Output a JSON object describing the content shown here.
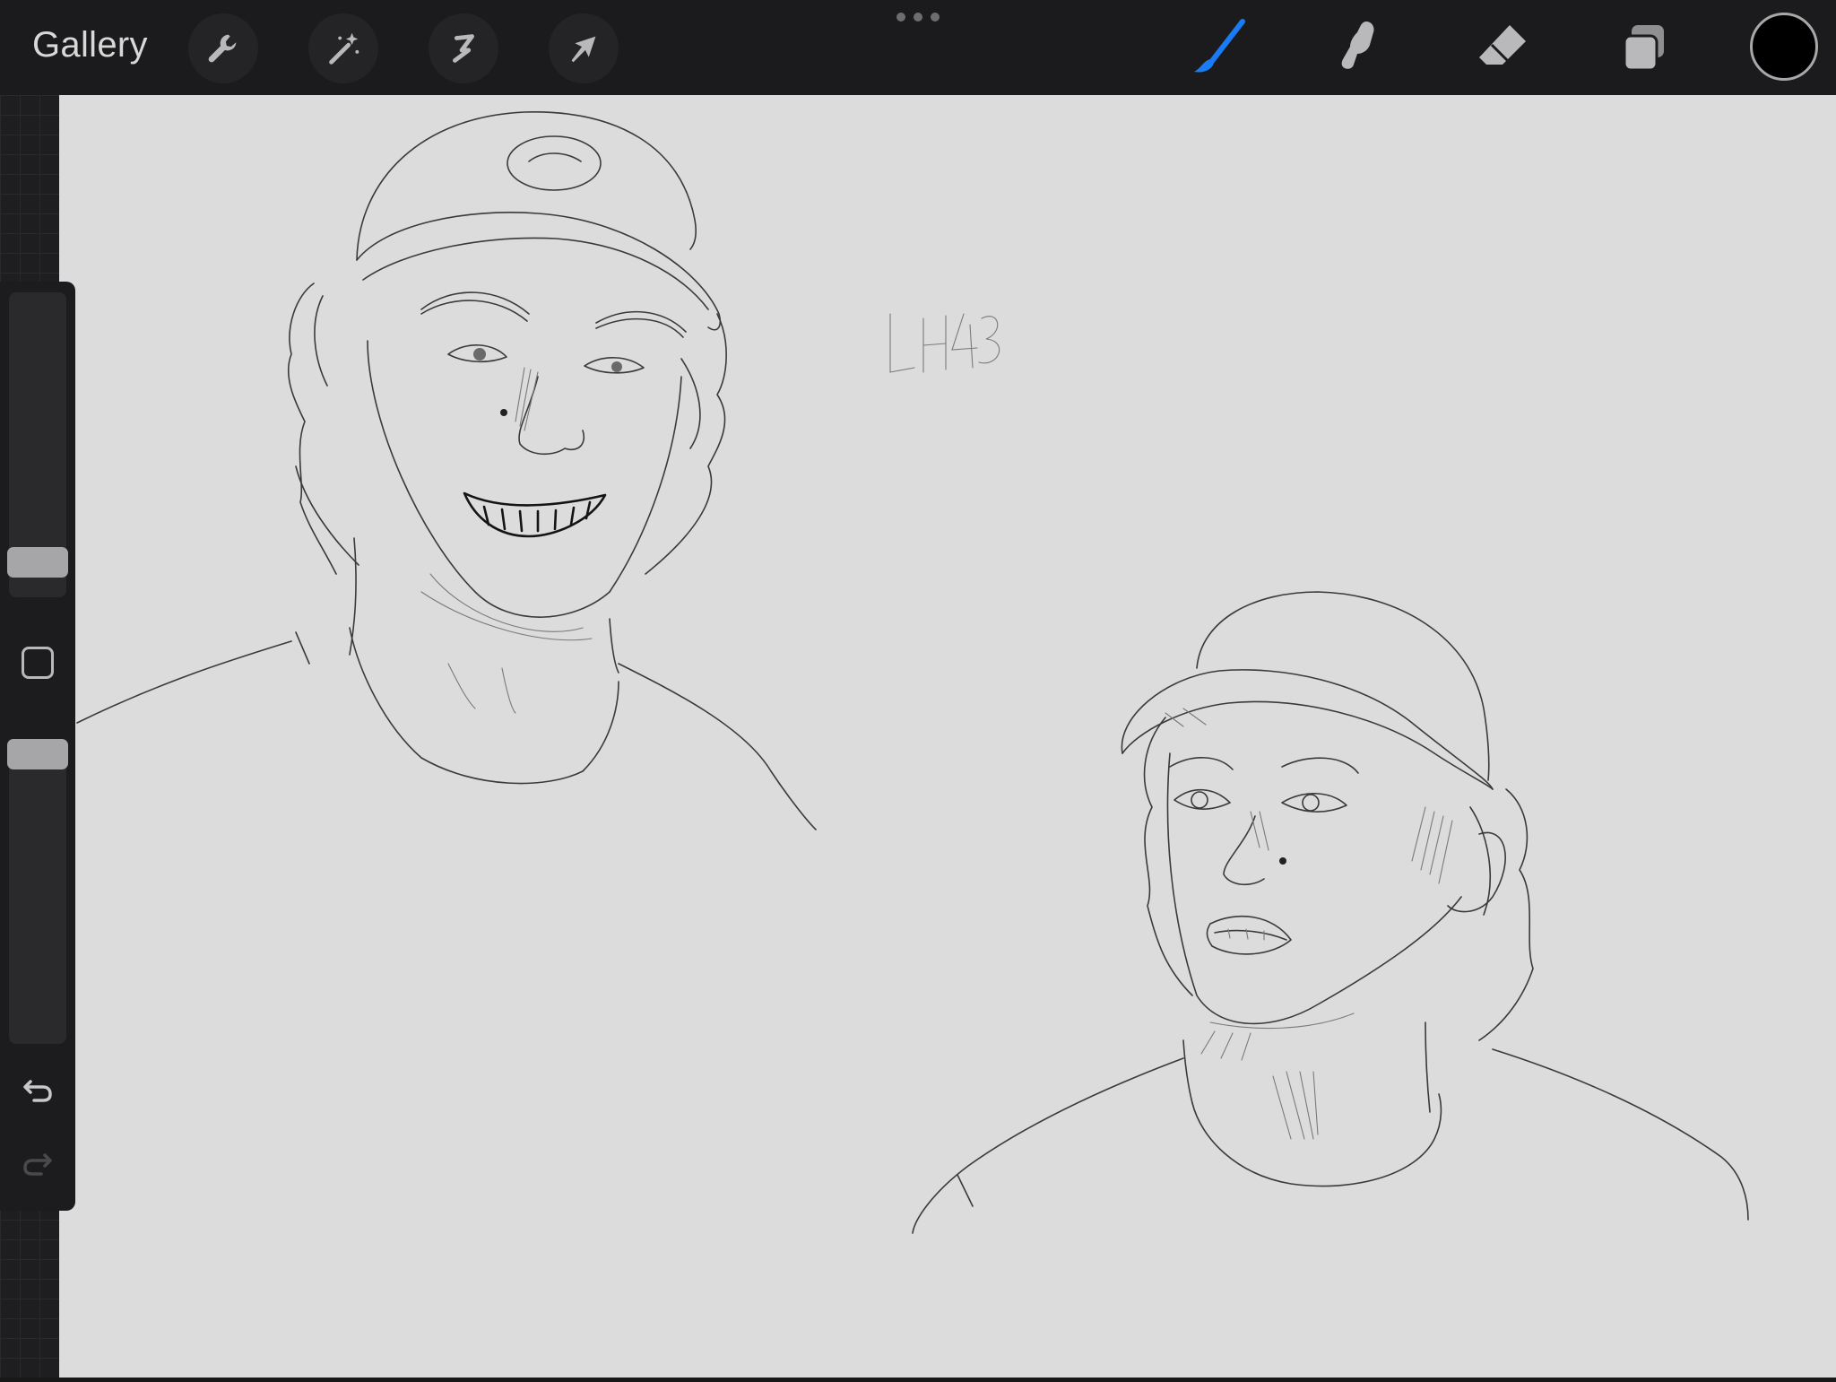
{
  "app": {
    "gallery_label": "Gallery"
  },
  "toolbar_left": [
    {
      "name": "actions",
      "icon": "wrench-icon"
    },
    {
      "name": "adjustments",
      "icon": "magic-wand-icon"
    },
    {
      "name": "selection",
      "icon": "selection-s-icon"
    },
    {
      "name": "transform",
      "icon": "arrow-cursor-icon"
    }
  ],
  "toolbar_right": [
    {
      "name": "brush",
      "icon": "brush-icon",
      "active": true,
      "color": "#1a7cf5"
    },
    {
      "name": "smudge",
      "icon": "smudge-finger-icon",
      "active": false
    },
    {
      "name": "eraser",
      "icon": "eraser-icon",
      "active": false
    },
    {
      "name": "layers",
      "icon": "layers-icon",
      "active": false
    }
  ],
  "current_color": "#000000",
  "sidebar": {
    "brush_size_level": 0.08,
    "opacity_level": 0.96
  },
  "canvas": {
    "background": "#dcdcdc",
    "signature": "LH43"
  }
}
